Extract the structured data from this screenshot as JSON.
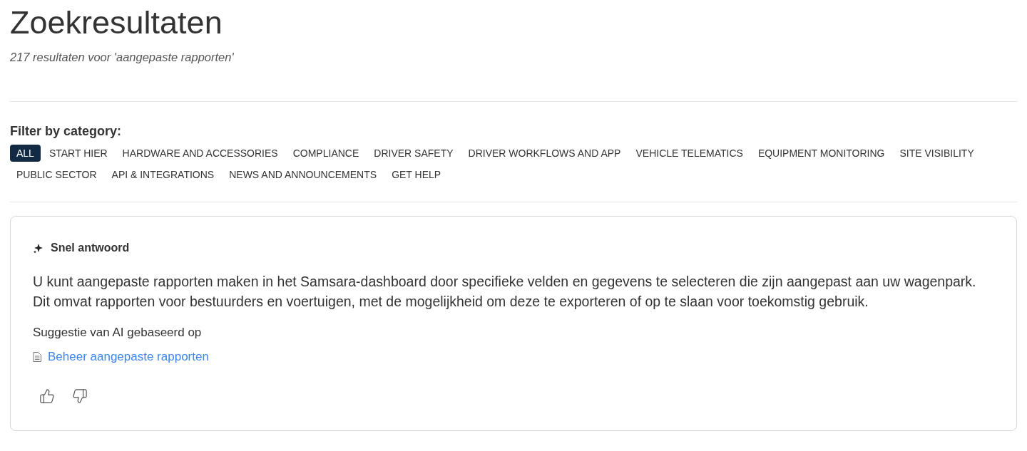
{
  "page": {
    "title": "Zoekresultaten",
    "subtitle": "217 resultaten voor 'aangepaste rapporten'"
  },
  "filter": {
    "label": "Filter by category:",
    "categories": [
      {
        "label": "ALL",
        "selected": true
      },
      {
        "label": "START HIER",
        "selected": false
      },
      {
        "label": "HARDWARE AND ACCESSORIES",
        "selected": false
      },
      {
        "label": "COMPLIANCE",
        "selected": false
      },
      {
        "label": "DRIVER SAFETY",
        "selected": false
      },
      {
        "label": "DRIVER WORKFLOWS AND APP",
        "selected": false
      },
      {
        "label": "VEHICLE TELEMATICS",
        "selected": false
      },
      {
        "label": "EQUIPMENT MONITORING",
        "selected": false
      },
      {
        "label": "SITE VISIBILITY",
        "selected": false
      },
      {
        "label": "PUBLIC SECTOR",
        "selected": false
      },
      {
        "label": "API & INTEGRATIONS",
        "selected": false
      },
      {
        "label": "NEWS AND ANNOUNCEMENTS",
        "selected": false
      },
      {
        "label": "GET HELP",
        "selected": false
      }
    ]
  },
  "quick_answer": {
    "heading": "Snel antwoord",
    "answer": "U kunt aangepaste rapporten maken in het Samsara-dashboard door specifieke velden en gegevens te selecteren die zijn aangepast aan uw wagenpark. Dit omvat rapporten voor bestuurders en voertuigen, met de mogelijkheid om deze te exporteren of op te slaan voor toekomstig gebruik.",
    "source_label": "Suggestie van AI gebaseerd op",
    "sources": [
      {
        "title": "Beheer aangepaste rapporten"
      }
    ]
  }
}
